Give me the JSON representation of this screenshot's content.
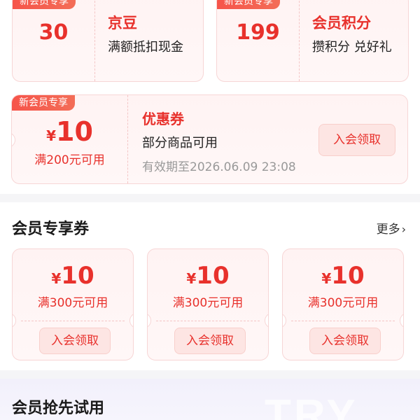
{
  "top_cards": [
    {
      "badge": "新会员专享",
      "value": "30",
      "title": "京豆",
      "desc": "满额抵扣现金"
    },
    {
      "badge": "新会员专享",
      "value": "199",
      "title": "会员积分",
      "desc": "攒积分 兑好礼"
    }
  ],
  "wide_coupon": {
    "badge": "新会员专享",
    "currency": "¥",
    "amount": "10",
    "condition": "满200元可用",
    "title": "优惠券",
    "desc": "部分商品可用",
    "validity": "有效期至2026.06.09 23:08",
    "button": "入会领取"
  },
  "exclusive": {
    "title": "会员专享券",
    "more": "更多",
    "coupons": [
      {
        "currency": "¥",
        "amount": "10",
        "condition": "满300元可用",
        "button": "入会领取"
      },
      {
        "currency": "¥",
        "amount": "10",
        "condition": "满300元可用",
        "button": "入会领取"
      },
      {
        "currency": "¥",
        "amount": "10",
        "condition": "满300元可用",
        "button": "入会领取"
      }
    ]
  },
  "trial": {
    "title": "会员抢先试用",
    "watermark": "TRY"
  },
  "colors": {
    "accent": "#e8312c",
    "badge": "#f6544a",
    "card_bg": "#fff3f3"
  }
}
